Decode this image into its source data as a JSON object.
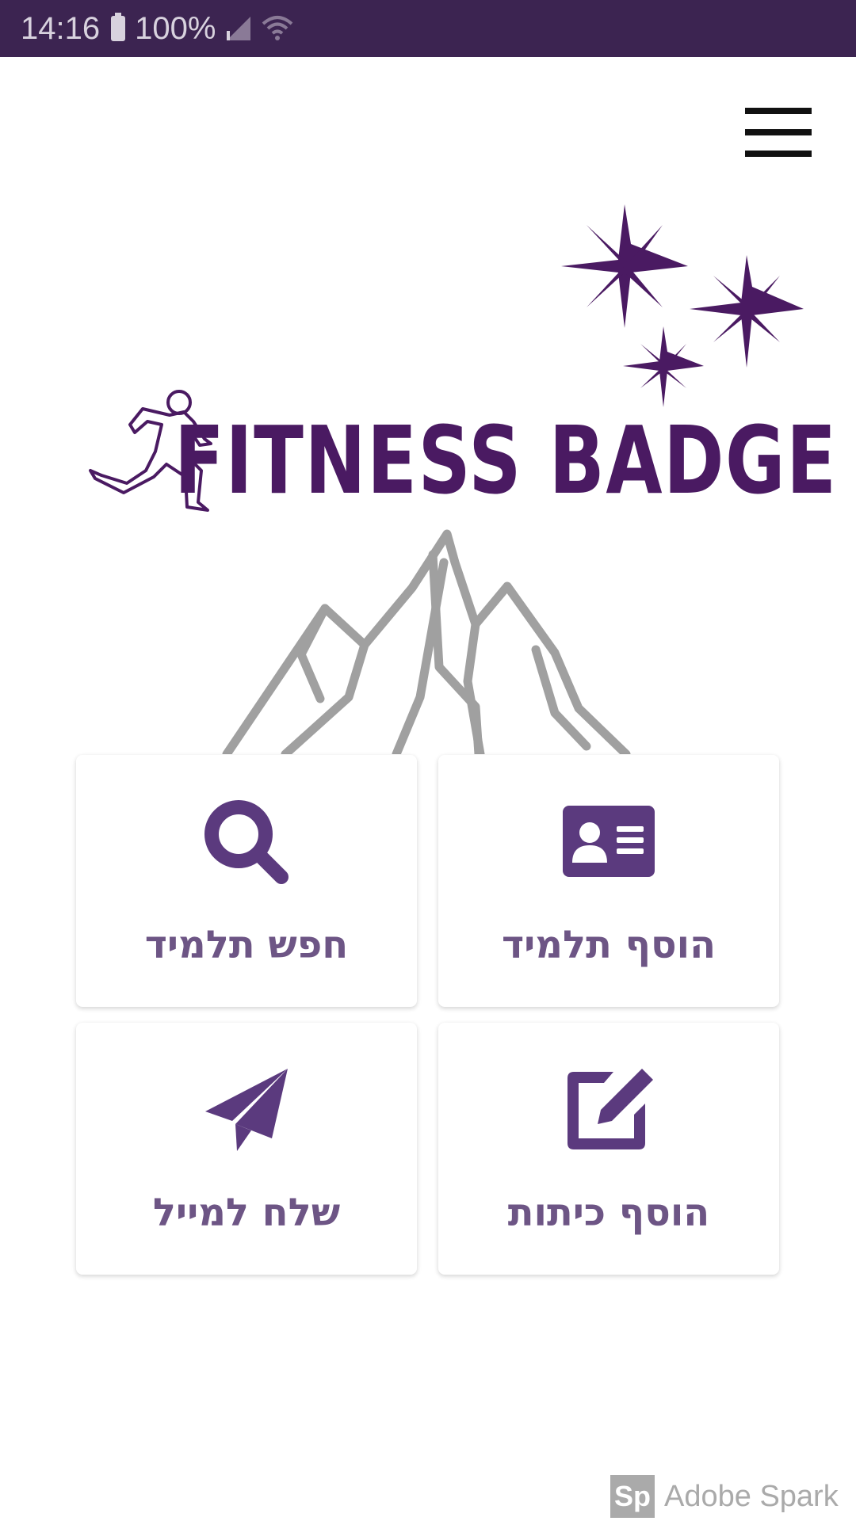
{
  "status_bar": {
    "time": "14:16",
    "battery": "100%",
    "icons": [
      "battery-icon",
      "signal-icon",
      "wifi-icon"
    ]
  },
  "header": {
    "menu_icon": "hamburger-menu-icon"
  },
  "hero": {
    "brand_title": "FITNESS BADGE",
    "icons": [
      "runner-icon",
      "sparkle-stars-icon",
      "mountain-icon"
    ]
  },
  "tiles": [
    {
      "label": "הוסף תלמיד",
      "icon": "id-card-icon"
    },
    {
      "label": "חפש תלמיד",
      "icon": "search-icon"
    },
    {
      "label": "הוסף כיתות",
      "icon": "edit-icon"
    },
    {
      "label": "שלח למייל",
      "icon": "paper-plane-icon"
    }
  ],
  "watermark": {
    "logo_text": "Sp",
    "text": "Adobe Spark"
  },
  "colors": {
    "status_bar": "#3c2451",
    "brand": "#4a1a62",
    "icon": "#5b3a7e",
    "label": "#6d5585",
    "mountain": "#a0a0a0"
  }
}
